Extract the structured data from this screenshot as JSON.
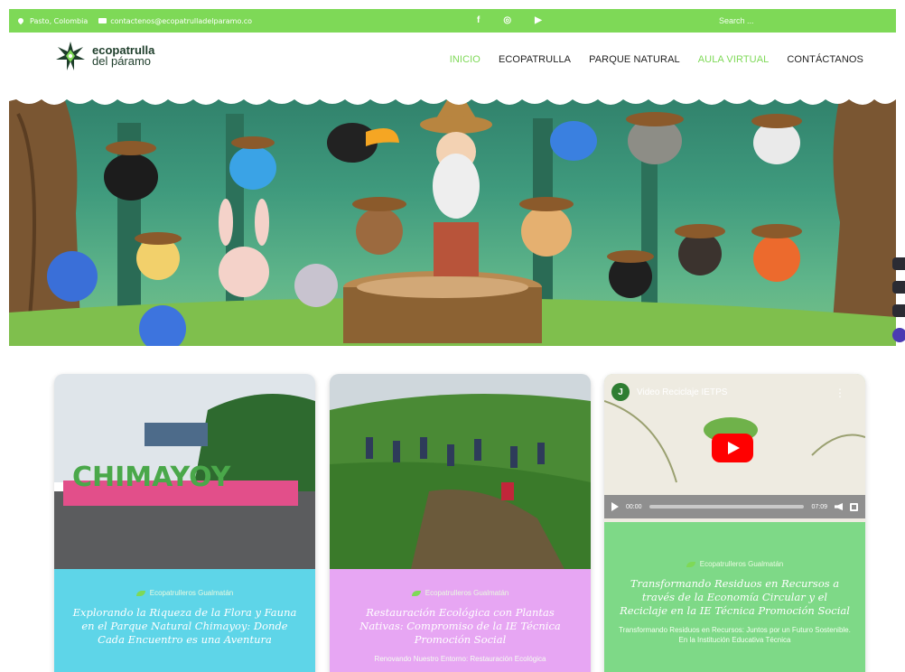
{
  "topbar": {
    "location": "Pasto, Colombia",
    "email": "contactenos@ecopatrulladelparamo.co",
    "social": [
      "f",
      "◎",
      "▶"
    ],
    "search_placeholder": "Search ..."
  },
  "brand": {
    "line1": "ecopatrulla",
    "line2": "del páramo"
  },
  "nav": {
    "items": [
      "INICIO",
      "ECOPATRULLA",
      "PARQUE NATURAL",
      "AULA VIRTUAL",
      "CONTÁCTANOS"
    ]
  },
  "cards": [
    {
      "category": "Ecopatrulleros Gualmatán",
      "title": "Explorando la Riqueza de la Flora y Fauna en el Parque Natural Chimayoy: Donde Cada Encuentro es una Aventura",
      "sign_text": "CHIMAYOY"
    },
    {
      "category": "Ecopatrulleros Gualmatán",
      "title": "Restauración Ecológica con Plantas Nativas: Compromiso de la IE Técnica Promoción Social",
      "excerpt": "Renovando Nuestro Entorno: Restauración Ecológica"
    },
    {
      "category": "Ecopatrulleros Gualmatán",
      "title": "Transformando Residuos en Recursos a través de la Economía Circular y el Reciclaje en la IE Técnica Promoción Social",
      "excerpt": "Transformando Residuos en Recursos: Juntos por un Futuro Sostenible. En la Institución Educativa Técnica",
      "video": {
        "avatar": "J",
        "title": "Video Reciclaje IETPS",
        "current": "00:00",
        "duration": "07:09"
      }
    }
  ],
  "colors": {
    "accent": "#7ed957",
    "card1": "#5ed5e8",
    "card2": "#e7a6f3",
    "card3": "#7ed987"
  }
}
